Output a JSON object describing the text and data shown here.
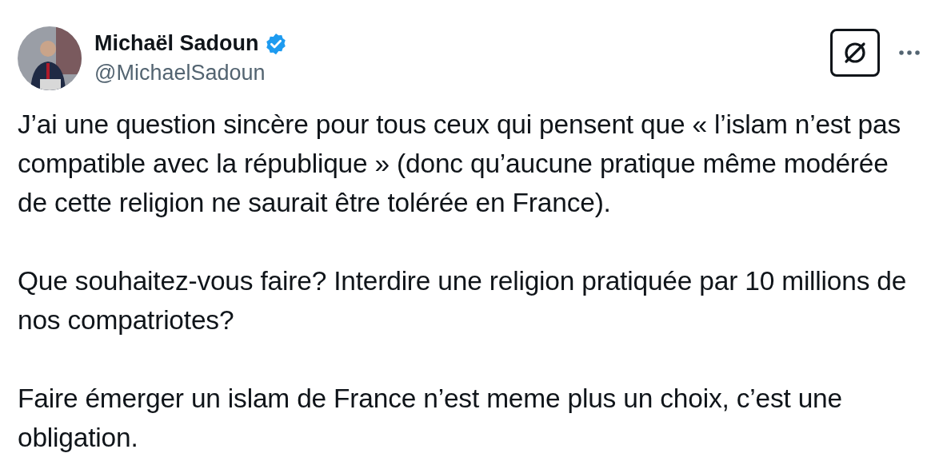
{
  "author": {
    "name": "Michaël Sadoun",
    "handle": "@MichaelSadoun",
    "verified": true
  },
  "paragraphs": [
    "J’ai une question sincère pour tous ceux qui pensent que « l’islam n’est pas compatible avec la république » (donc qu’aucune pratique même modérée de cette religion ne saurait être tolérée en France).",
    "Que souhaitez-vous faire? Interdire une religion pratiquée par 10 millions de nos compatriotes?",
    "Faire émerger un islam de France n’est meme plus un choix, c’est une obligation."
  ]
}
